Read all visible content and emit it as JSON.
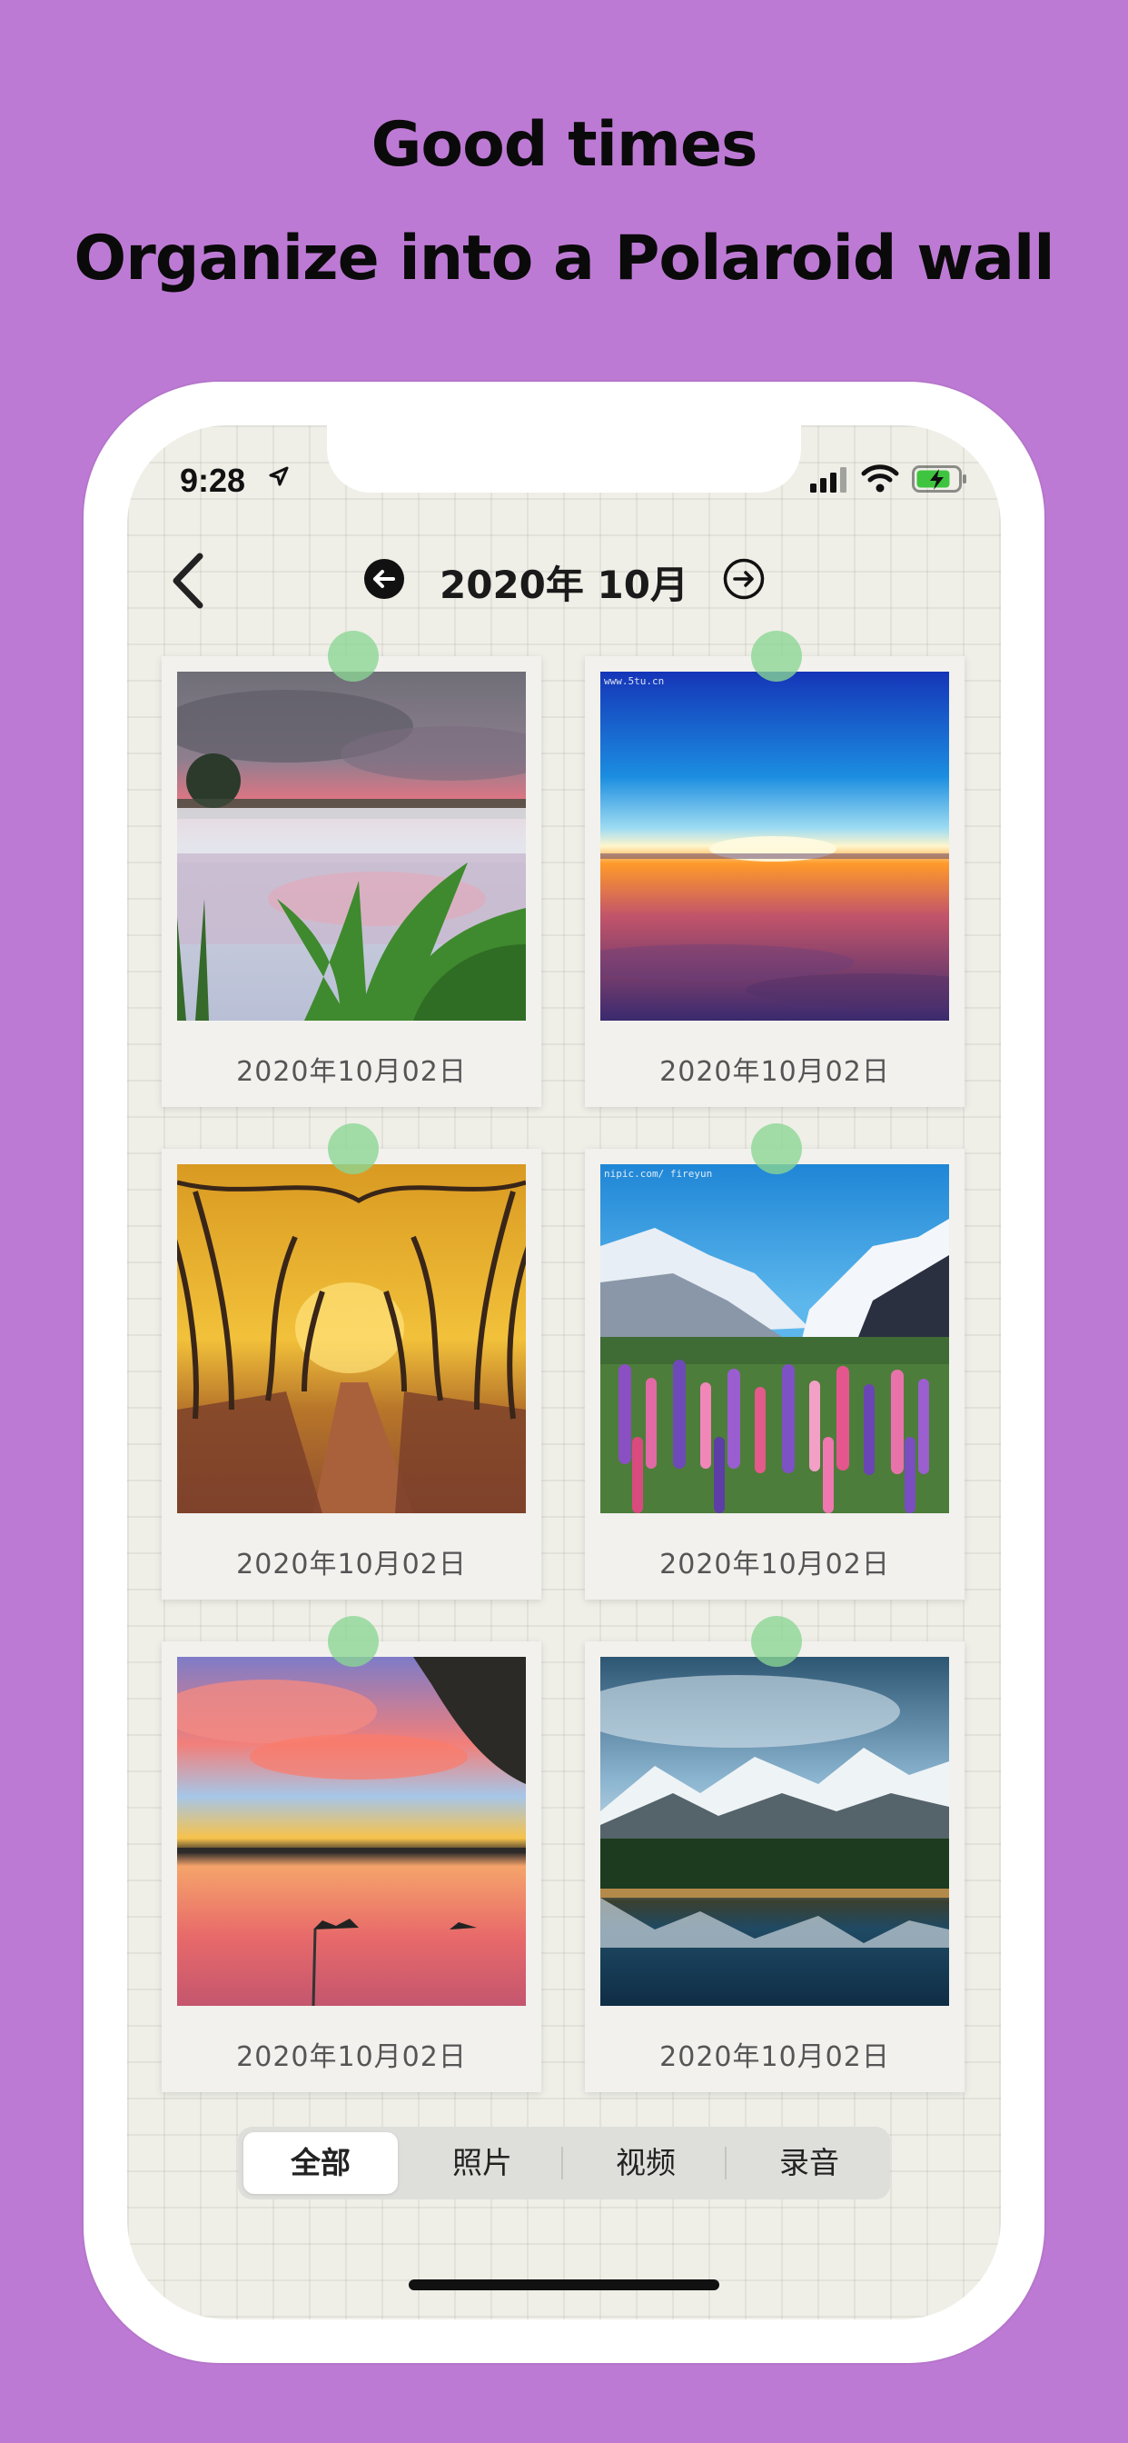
{
  "headline": {
    "line1": "Good times",
    "line2": "Organize into a Polaroid wall"
  },
  "status_bar": {
    "time": "9:28"
  },
  "nav": {
    "title": "2020年 10月"
  },
  "cards": [
    {
      "date": "2020年10月02日",
      "image": "misty lake at sunset with reeds"
    },
    {
      "date": "2020年10月02日",
      "image": "sunrise over sea of clouds",
      "watermark": "www.5tu.cn"
    },
    {
      "date": "2020年10月02日",
      "image": "golden autumn tree-lined avenue"
    },
    {
      "date": "2020年10月02日",
      "image": "lupine flowers below snowy mountains",
      "watermark": "nipic.com/ fireyun"
    },
    {
      "date": "2020年10月02日",
      "image": "pink sunset reflected in a lake with birds"
    },
    {
      "date": "2020年10月02日",
      "image": "snowy mountains and forest reflected in lake"
    }
  ],
  "segments": [
    {
      "label": "全部",
      "active": true
    },
    {
      "label": "照片",
      "active": false
    },
    {
      "label": "视频",
      "active": false
    },
    {
      "label": "录音",
      "active": false
    }
  ],
  "colors": {
    "background": "#bd7ad4",
    "pin": "#8ad694",
    "screen": "#efefe8"
  }
}
